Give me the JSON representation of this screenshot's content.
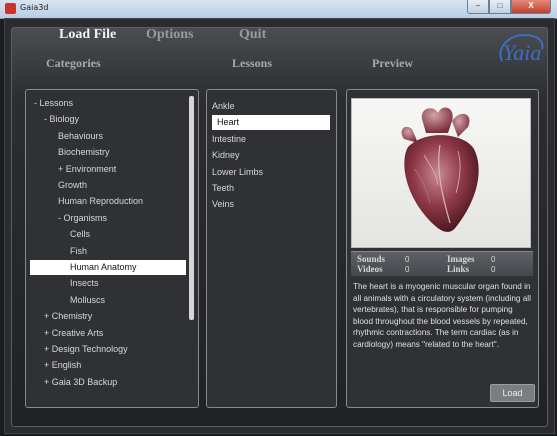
{
  "window": {
    "title": "Gaia3d",
    "close": "X",
    "minimize": "–",
    "maximize": "□"
  },
  "menu": {
    "load_file": "Load File",
    "options": "Options",
    "quit": "Quit"
  },
  "logo_text": "Yaia",
  "headers": {
    "categories": "Categories",
    "lessons": "Lessons",
    "preview": "Preview"
  },
  "categories": [
    {
      "label": "- Lessons",
      "indent": 0
    },
    {
      "label": "- Biology",
      "indent": 1
    },
    {
      "label": "Behaviours",
      "indent": 2
    },
    {
      "label": "Biochemistry",
      "indent": 2
    },
    {
      "label": "+ Environment",
      "indent": 2
    },
    {
      "label": "Growth",
      "indent": 2
    },
    {
      "label": "Human Reproduction",
      "indent": 2
    },
    {
      "label": "- Organisms",
      "indent": 2
    },
    {
      "label": "Cells",
      "indent": 3
    },
    {
      "label": "Fish",
      "indent": 3
    },
    {
      "label": "Human Anatomy",
      "indent": 3,
      "selected": true
    },
    {
      "label": "Insects",
      "indent": 3
    },
    {
      "label": "Molluscs",
      "indent": 3
    },
    {
      "label": "+ Chemistry",
      "indent": 1
    },
    {
      "label": "+ Creative Arts",
      "indent": 1
    },
    {
      "label": "+ Design Technology",
      "indent": 1
    },
    {
      "label": "+ English",
      "indent": 1
    },
    {
      "label": "+ Gaia 3D Backup",
      "indent": 1
    }
  ],
  "lessons": [
    {
      "label": "Ankle"
    },
    {
      "label": "Heart",
      "selected": true
    },
    {
      "label": "Intestine"
    },
    {
      "label": "Kidney"
    },
    {
      "label": "Lower Limbs"
    },
    {
      "label": "Teeth"
    },
    {
      "label": "Veins"
    }
  ],
  "preview": {
    "sounds_label": "Sounds",
    "sounds_value": "0",
    "images_label": "Images",
    "images_value": "0",
    "videos_label": "Videos",
    "videos_value": "0",
    "links_label": "Links",
    "links_value": "0",
    "description": "The heart is a myogenic muscular organ found in all animals with a circulatory system (including all vertebrates), that is responsible for pumping blood throughout the blood vessels by repeated, rhythmic contractions. The term cardiac (as in cardiology) means \"related to the heart\".",
    "load_label": "Load"
  }
}
